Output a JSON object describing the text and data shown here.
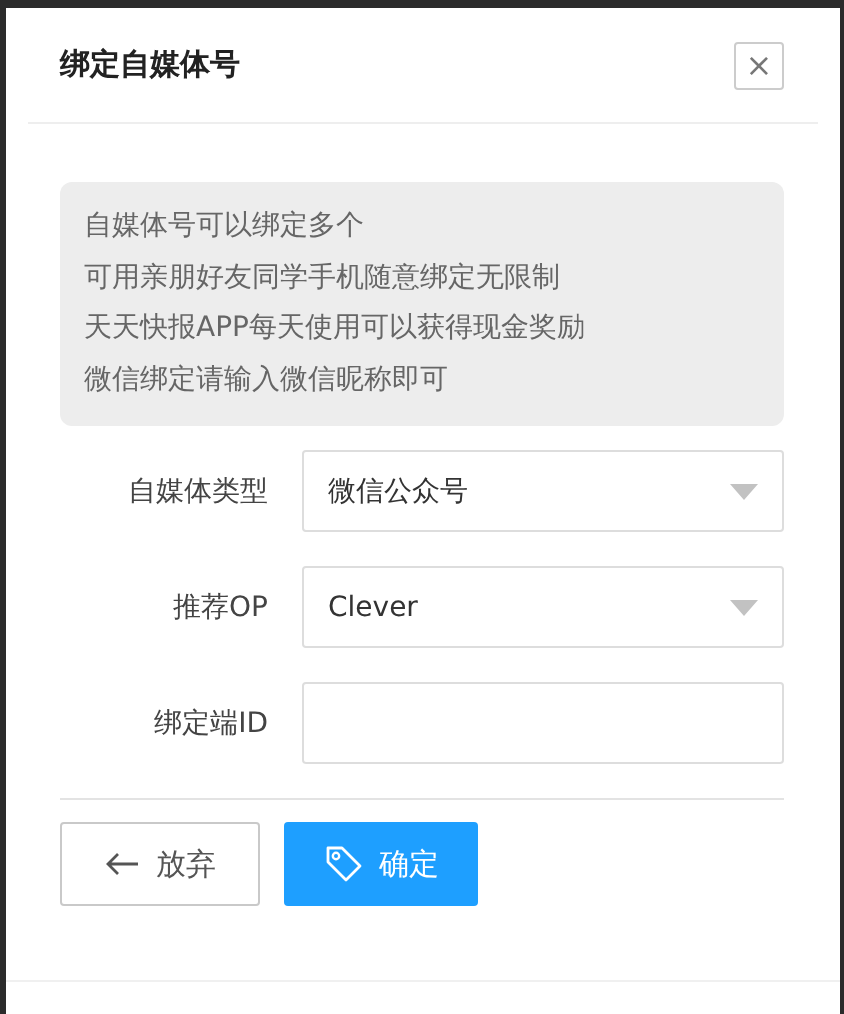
{
  "dialog": {
    "title": "绑定自媒体号",
    "close": "×"
  },
  "notice": [
    "自媒体号可以绑定多个",
    "可用亲朋好友同学手机随意绑定无限制",
    "天天快报APP每天使用可以获得现金奖励",
    "微信绑定请输入微信昵称即可"
  ],
  "fields": [
    {
      "kind": "select",
      "label": "自媒体类型",
      "value": "微信公众号"
    },
    {
      "kind": "select",
      "label": "推荐OP",
      "value": "Clever"
    },
    {
      "kind": "input",
      "label": "绑定端ID"
    }
  ],
  "buttons": [
    {
      "kind": "cancel",
      "label": "放弃"
    },
    {
      "kind": "confirm",
      "label": "确定"
    }
  ]
}
